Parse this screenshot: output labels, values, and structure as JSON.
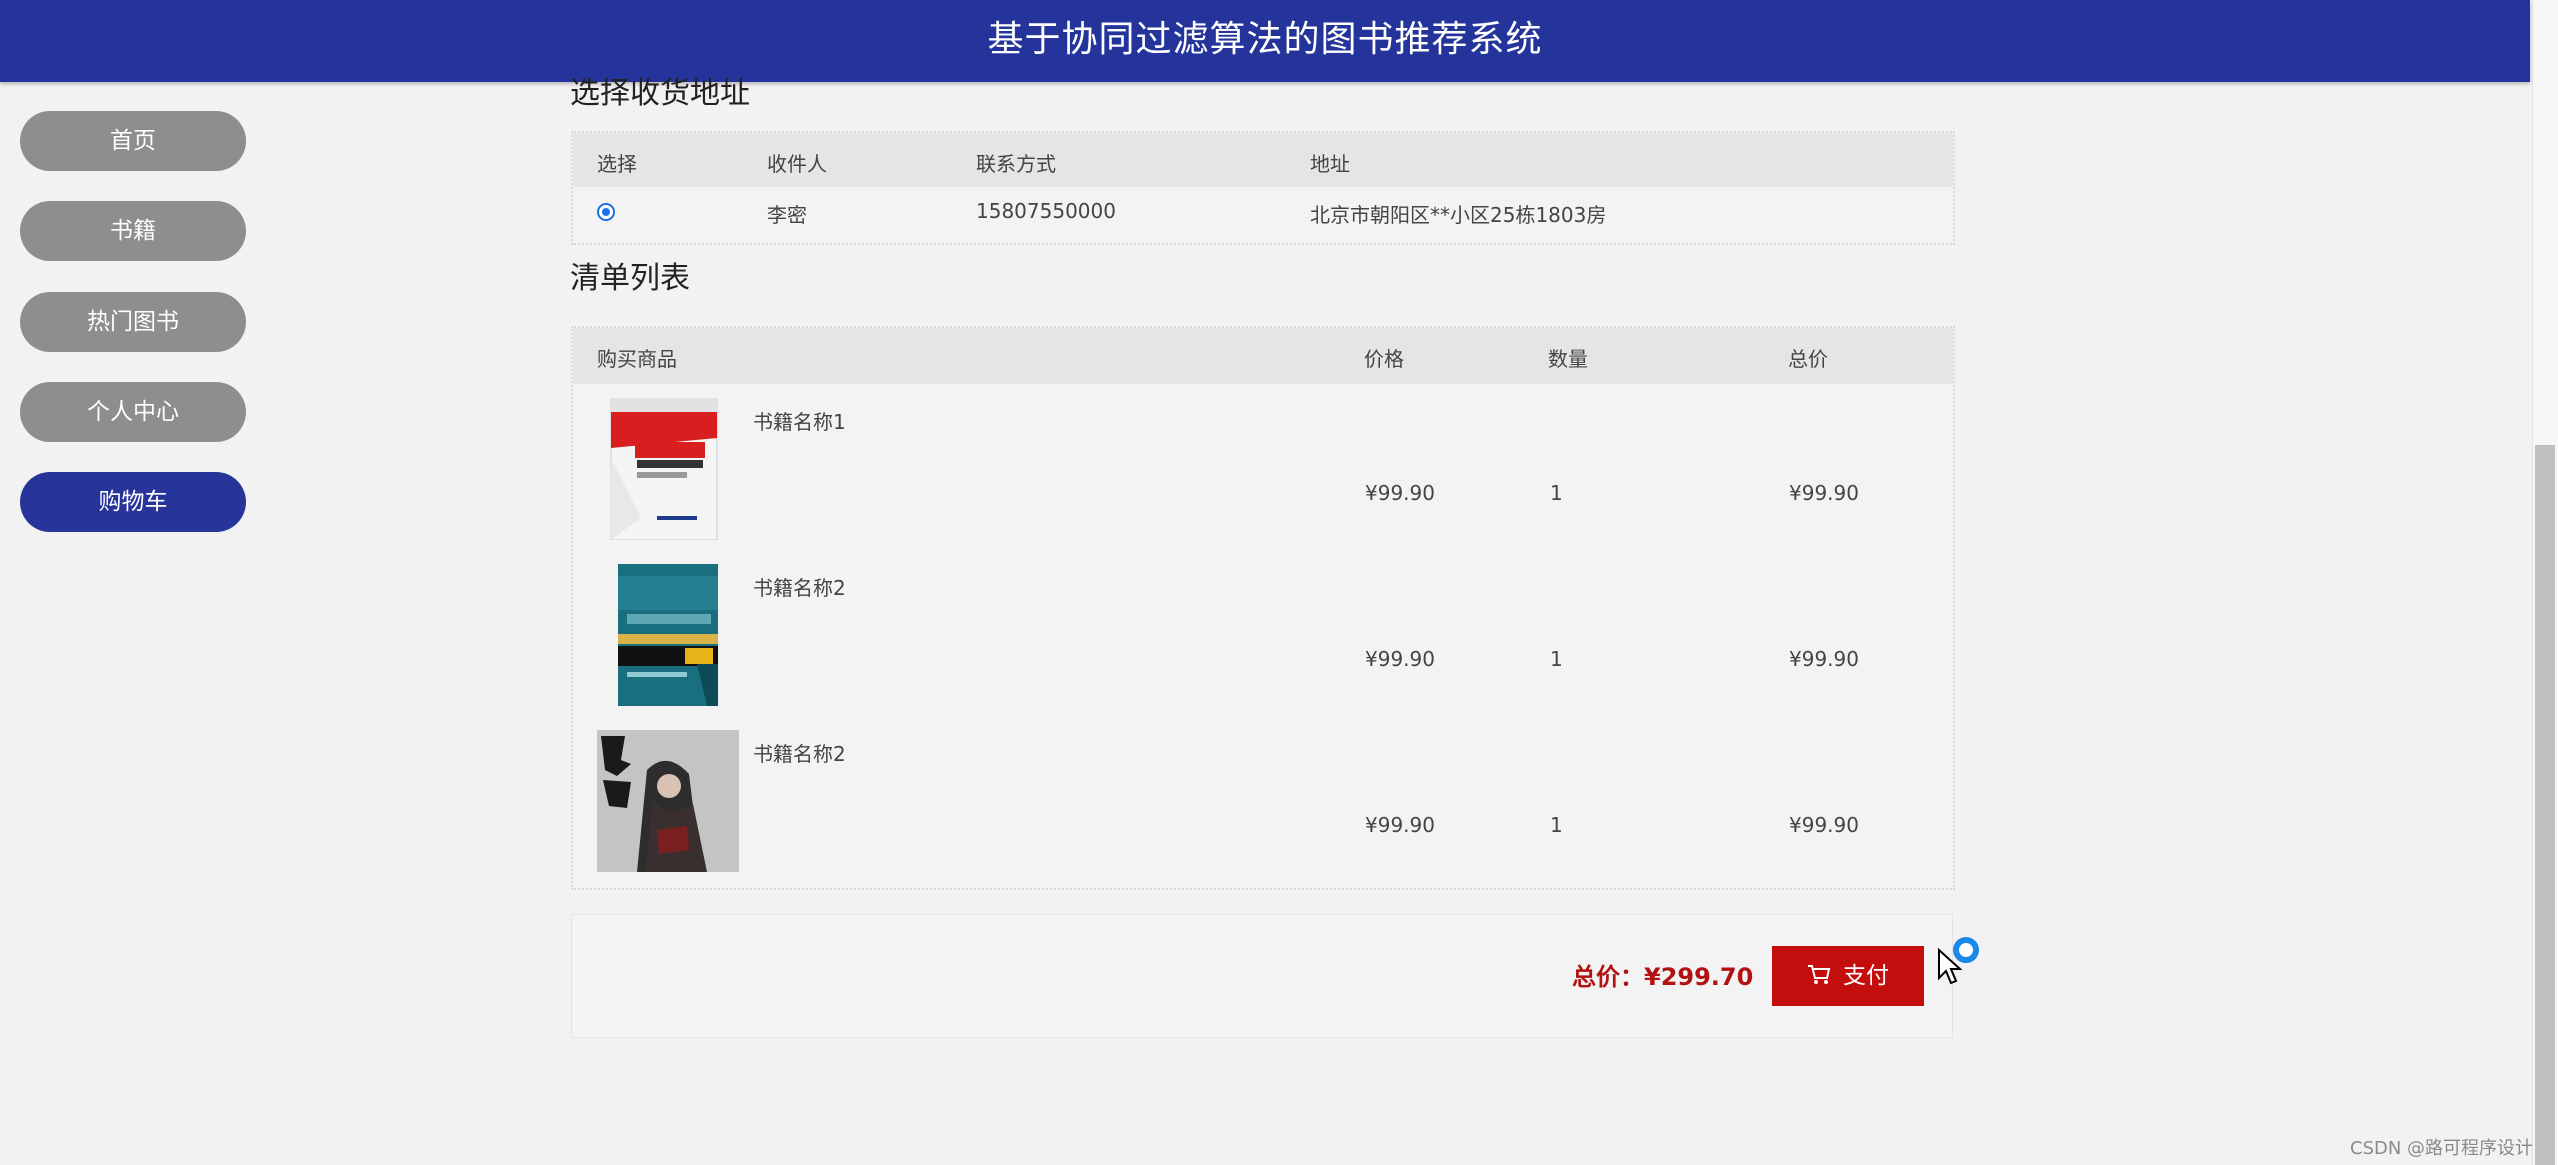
{
  "header": {
    "title": "基于协同过滤算法的图书推荐系统"
  },
  "sidebar": {
    "items": [
      {
        "label": "首页",
        "active": false
      },
      {
        "label": "书籍",
        "active": false
      },
      {
        "label": "热门图书",
        "active": false
      },
      {
        "label": "个人中心",
        "active": false
      },
      {
        "label": "购物车",
        "active": true
      }
    ]
  },
  "address_section": {
    "title": "选择收货地址",
    "columns": [
      "选择",
      "收件人",
      "联系方式",
      "地址"
    ],
    "rows": [
      {
        "selected": true,
        "recipient": "李密",
        "phone": "15807550000",
        "address": "北京市朝阳区**小区25栋1803房"
      }
    ]
  },
  "list_section": {
    "title": "清单列表",
    "columns": [
      "购买商品",
      "价格",
      "数量",
      "总价"
    ],
    "rows": [
      {
        "name": "书籍名称1",
        "price": "¥99.90",
        "qty": "1",
        "total": "¥99.90",
        "cover_icon": "book-cover-exam"
      },
      {
        "name": "书籍名称2",
        "price": "¥99.90",
        "qty": "1",
        "total": "¥99.90",
        "cover_icon": "book-cover-2020"
      },
      {
        "name": "书籍名称2",
        "price": "¥99.90",
        "qty": "1",
        "total": "¥99.90",
        "cover_icon": "book-cover-jianlai"
      }
    ]
  },
  "summary": {
    "total_label": "总价：¥299.70",
    "pay_label": "支付"
  },
  "colors": {
    "brand": "#25349b",
    "pay": "#c40d0d",
    "price": "#b31212",
    "nav_inactive": "#8e8e8e"
  },
  "watermark": "CSDN @路可程序设计"
}
